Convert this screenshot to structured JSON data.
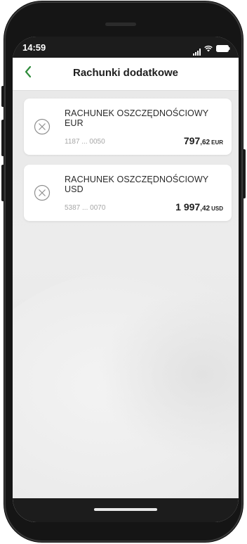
{
  "status_bar": {
    "time": "14:59",
    "icons": [
      "signal-icon",
      "wifi-icon",
      "battery-icon"
    ]
  },
  "header": {
    "title": "Rachunki dodatkowe",
    "back_icon": "chevron-left-icon"
  },
  "accounts": [
    {
      "name": "RACHUNEK OSZCZĘDNOŚCIOWY EUR",
      "number": "1187 ... 0050",
      "amount_whole": "797",
      "amount_fraction": ",62",
      "currency": "EUR",
      "icon": "remove-circle-icon"
    },
    {
      "name": "RACHUNEK OSZCZĘDNOŚCIOWY USD",
      "number": "5387 ... 0070",
      "amount_whole": "1 997",
      "amount_fraction": ",42",
      "currency": "USD",
      "icon": "remove-circle-icon"
    }
  ],
  "colors": {
    "accent": "#2e8b3a",
    "text_primary": "#1e1e1e",
    "text_secondary": "#a6a6a6",
    "background": "#e8e8e8"
  }
}
